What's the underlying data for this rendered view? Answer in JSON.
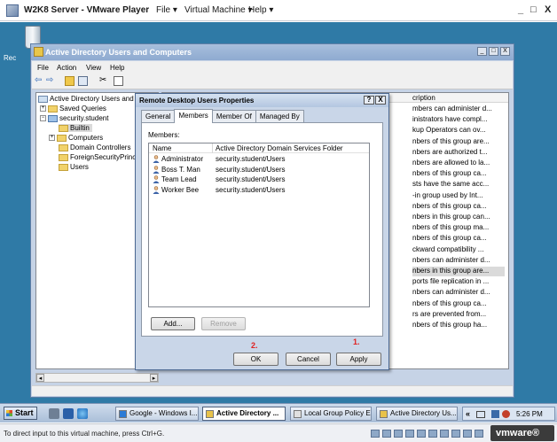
{
  "vmware": {
    "title": "W2K8 Server - VMware Player",
    "menu": [
      "File ▾",
      "Virtual Machine ▾",
      "Help ▾"
    ],
    "controls": [
      "_",
      "□",
      "X"
    ],
    "status_hint": "To direct input to this virtual machine, press Ctrl+G.",
    "brand": "vmware®"
  },
  "desktop": {
    "recycle_label": "Rec"
  },
  "aduc": {
    "title": "Active Directory Users and Computers",
    "menu": [
      "File",
      "Action",
      "View",
      "Help"
    ],
    "tree": {
      "root": "Active Directory Users and C",
      "saved_queries": "Saved Queries",
      "domain": "security.student",
      "builtin": "Builtin",
      "computers": "Computers",
      "domain_controllers": "Domain Controllers",
      "foreign": "ForeignSecurityPrinci",
      "users": "Users"
    },
    "right_header": "cription",
    "descriptions": [
      "mbers can administer d...",
      "inistrators have compl...",
      "kup Operators can ov...",
      "nbers of this group are...",
      "nbers are authorized t...",
      "nbers are allowed to la...",
      "nbers of this group ca...",
      "sts have the same acc...",
      "-in group used by Int...",
      "nbers of this group ca...",
      "nbers in this group can...",
      "nbers of this group ma...",
      "nbers of this group ca...",
      "ckward compatibility ...",
      "nbers can administer d...",
      "nbers in this group are...",
      "ports file replication in ...",
      "nbers can administer d...",
      "nbers of this group ca...",
      "rs are prevented from...",
      "nbers of this group ha..."
    ],
    "selected_description_index": 15
  },
  "dialog": {
    "title": "Remote Desktop Users Properties",
    "help_btn": "?",
    "close_btn": "X",
    "tabs": [
      "General",
      "Members",
      "Member Of",
      "Managed By"
    ],
    "active_tab": "Members",
    "members_label": "Members:",
    "columns": {
      "name": "Name",
      "folder": "Active Directory Domain Services Folder"
    },
    "members": [
      {
        "name": "Administrator",
        "folder": "security.student/Users"
      },
      {
        "name": "Boss T. Man",
        "folder": "security.student/Users"
      },
      {
        "name": "Team Lead",
        "folder": "security.student/Users"
      },
      {
        "name": "Worker Bee",
        "folder": "security.student/Users"
      }
    ],
    "add_btn": "Add...",
    "remove_btn": "Remove",
    "ok_btn": "OK",
    "cancel_btn": "Cancel",
    "apply_btn": "Apply",
    "annot_1": "1.",
    "annot_2": "2."
  },
  "taskbar": {
    "start": "Start",
    "tasks": [
      "Google - Windows I...",
      "Active Directory ...",
      "Local Group Policy E...",
      "Active Directory Us..."
    ],
    "active_task_index": 1,
    "tray_chevron": "«",
    "clock": "5:26 PM"
  }
}
